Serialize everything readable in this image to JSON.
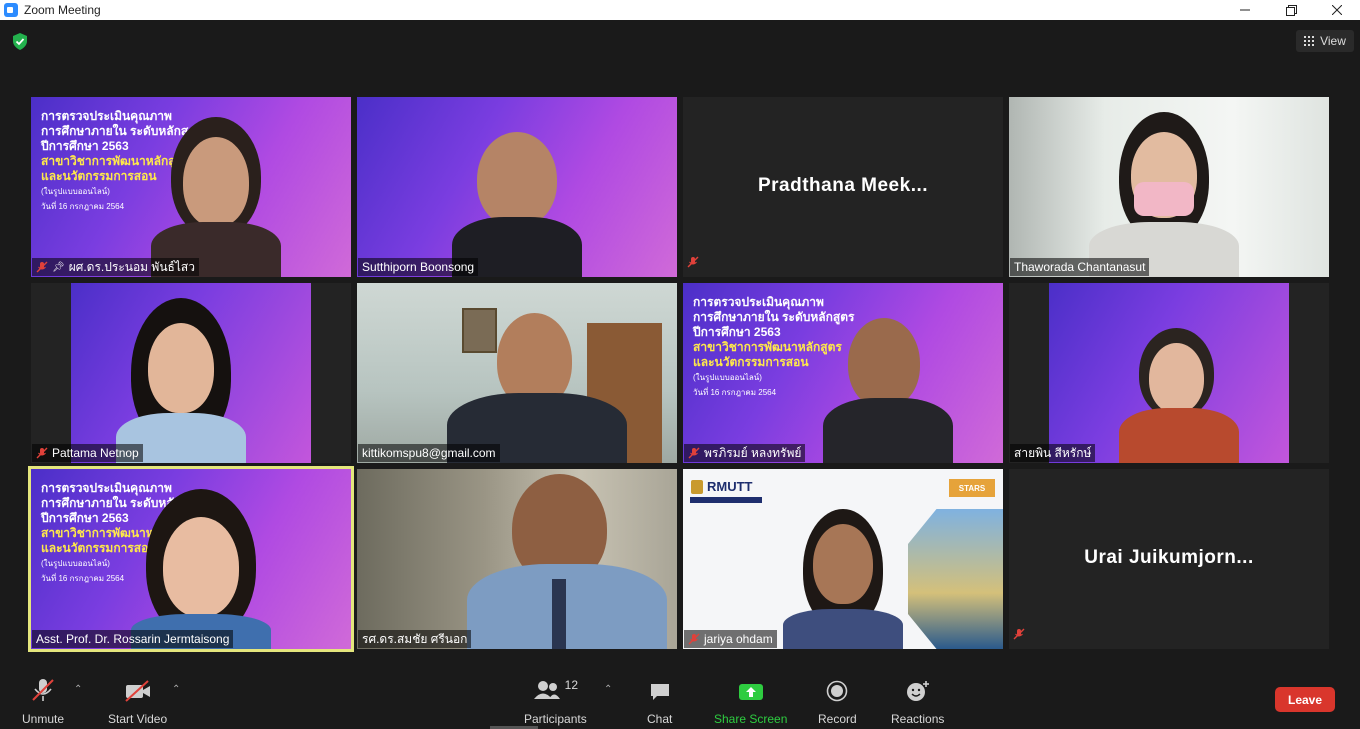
{
  "window": {
    "title": "Zoom Meeting"
  },
  "header": {
    "view_label": "View"
  },
  "slide": {
    "line1": "การตรวจประเมินคุณภาพ",
    "line2": "การศึกษาภายใน ระดับหลักสูตร",
    "line3": "ปีการศึกษา 2563",
    "line4": "สาขาวิชาการพัฒนาหลักสูตร",
    "line5": "และนวัตกรรมการสอน",
    "line6": "(ในรูปแบบออนไลน์)",
    "line7": "วันที่ 16 กรกฎาคม 2564"
  },
  "participants": [
    {
      "name": "ผศ.ดร.ประนอม พันธ์ไสว",
      "muted": true,
      "pinned": true
    },
    {
      "name": "Sutthiporn Boonsong",
      "muted": false
    },
    {
      "name": "Pradthana Meek...",
      "muted": true,
      "video_off": true
    },
    {
      "name": "Thaworada Chantanasut",
      "muted": false
    },
    {
      "name": "Pattama Netnop",
      "muted": true
    },
    {
      "name": "kittikomspu8@gmail.com",
      "muted": false
    },
    {
      "name": "พรภิรมย์ หลงทรัพย์",
      "muted": true
    },
    {
      "name": "สายพิน สีหรักษ์",
      "muted": false
    },
    {
      "name": "Asst. Prof. Dr. Rossarin  Jermtaisong",
      "muted": false,
      "active_speaker": true
    },
    {
      "name": "รศ.ดร.สมชัย ศรีนอก",
      "muted": false
    },
    {
      "name": "jariya ohdam",
      "muted": true
    },
    {
      "name": "Urai  Juikumjorn...",
      "muted": true,
      "video_off": true
    }
  ],
  "jariya_slide": {
    "logo": "RMUTT",
    "badge": "STARS"
  },
  "toolbar": {
    "unmute_label": "Unmute",
    "start_video_label": "Start Video",
    "participants_label": "Participants",
    "participants_count": "12",
    "chat_label": "Chat",
    "share_label": "Share Screen",
    "record_label": "Record",
    "reactions_label": "Reactions",
    "leave_label": "Leave"
  },
  "colors": {
    "accent_green": "#2ecc40",
    "leave_red": "#d9362c",
    "active_speaker": "#e4e67c",
    "mute_red": "#e0413a"
  }
}
